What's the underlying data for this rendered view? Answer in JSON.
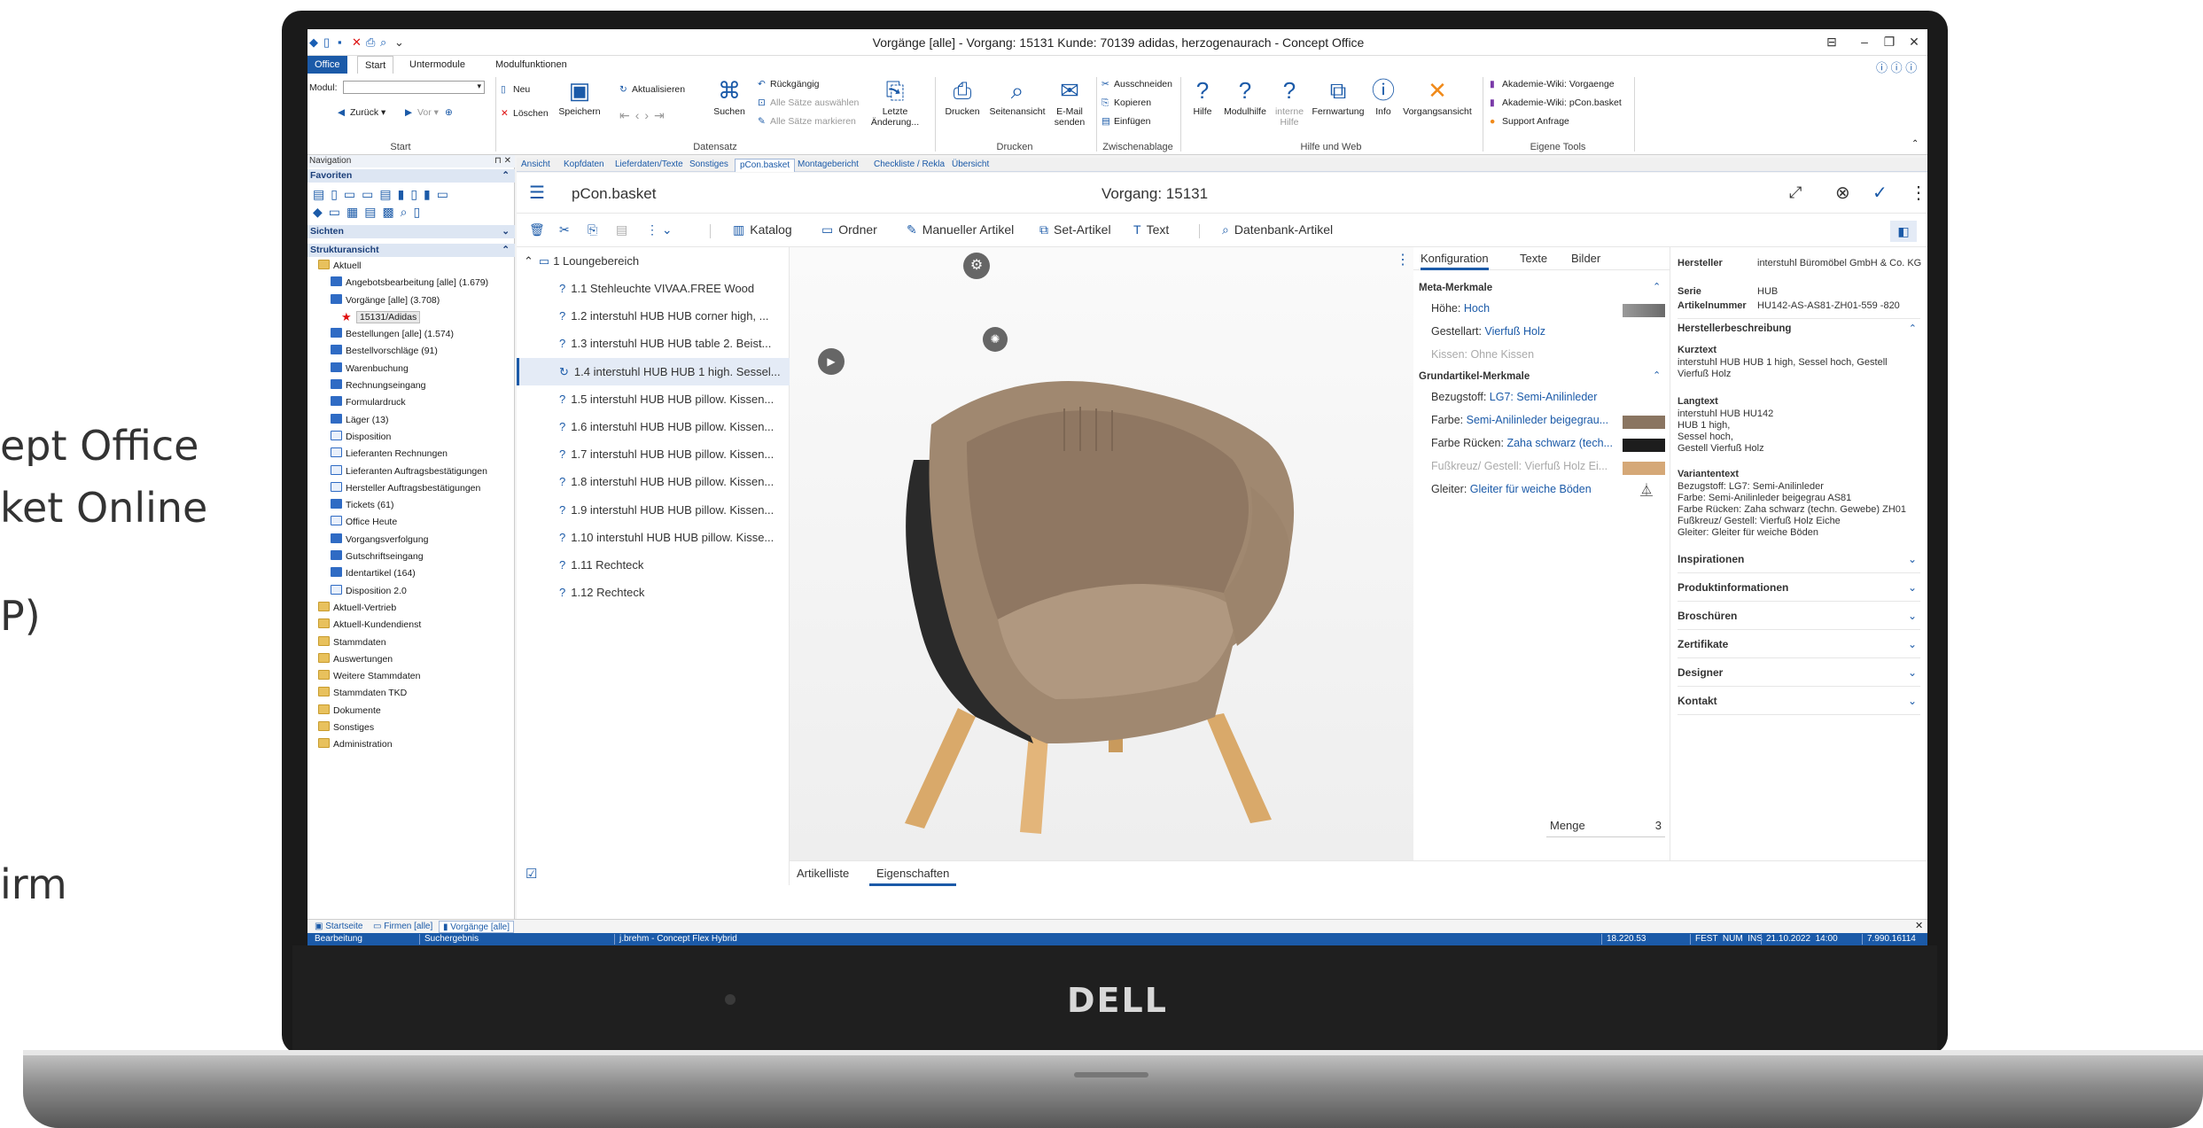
{
  "left_marketing": [
    "ept Office",
    "ket Online",
    "P)",
    "irm"
  ],
  "brand": "DELL",
  "window": {
    "title": "Vorgänge [alle] - Vorgang: 15131 Kunde: 70139 adidas, herzogenaurach - Concept Office",
    "controls": [
      "⊟",
      "–",
      "❐",
      "✕"
    ]
  },
  "ribbon_tabs": [
    "Office",
    "Start",
    "Untermodule",
    "Modulfunktionen"
  ],
  "ribbon": {
    "modul_label": "Modul:",
    "zurueck": "Zurück",
    "vor": "Vor",
    "group_start": "Start",
    "neu": "Neu",
    "loeschen": "Löschen",
    "speichern": "Speichern",
    "aktualisieren": "Aktualisieren",
    "suchen": "Suchen",
    "rueckgaengig": "Rückgängig",
    "alle_saetze_auswaehlen": "Alle Sätze auswählen",
    "alle_saetze_markieren": "Alle Sätze markieren",
    "letzte_aenderung": "Letzte Änderung...",
    "group_datensatz": "Datensatz",
    "drucken": "Drucken",
    "seitenansicht": "Seitenansicht",
    "email_senden": "E-Mail senden",
    "group_drucken": "Drucken",
    "ausschneiden": "Ausschneiden",
    "kopieren": "Kopieren",
    "einfuegen": "Einfügen",
    "group_zwischenablage": "Zwischenablage",
    "hilfe": "Hilfe",
    "modulhilfe": "Modulhilfe",
    "interne_hilfe": "interne Hilfe",
    "fernwartung": "Fernwartung",
    "info": "Info",
    "vorgangsansicht": "Vorgangsansicht",
    "group_hilfe": "Hilfe und Web",
    "wiki_vorgaenge": "Akademie-Wiki: Vorgaenge",
    "wiki_pcon": "Akademie-Wiki: pCon.basket",
    "support": "Support Anfrage",
    "group_tools": "Eigene Tools"
  },
  "nav": {
    "title": "Navigation",
    "favoriten": "Favoriten",
    "sichten": "Sichten",
    "strukturansicht": "Strukturansicht",
    "tree": [
      {
        "label": "Aktuell",
        "level": 1,
        "icon": "folder"
      },
      {
        "label": "Angebotsbearbeitung [alle] (1.679)",
        "level": 2,
        "icon": "doc"
      },
      {
        "label": "Vorgänge [alle] (3.708)",
        "level": 2,
        "icon": "doc"
      },
      {
        "label": "15131/Adidas",
        "level": 3,
        "icon": "star",
        "selected": true
      },
      {
        "label": "Bestellungen [alle] (1.574)",
        "level": 2,
        "icon": "doc"
      },
      {
        "label": "Bestellvorschläge (91)",
        "level": 2,
        "icon": "doc"
      },
      {
        "label": "Warenbuchung",
        "level": 2,
        "icon": "doc"
      },
      {
        "label": "Rechnungseingang",
        "level": 2,
        "icon": "doc"
      },
      {
        "label": "Formulardruck",
        "level": 2,
        "icon": "doc"
      },
      {
        "label": "Läger (13)",
        "level": 2,
        "icon": "doc"
      },
      {
        "label": "Disposition",
        "level": 2,
        "icon": "docout"
      },
      {
        "label": "Lieferanten Rechnungen",
        "level": 2,
        "icon": "docout"
      },
      {
        "label": "Lieferanten Auftragsbestätigungen",
        "level": 2,
        "icon": "docout"
      },
      {
        "label": "Hersteller Auftragsbestätigungen",
        "level": 2,
        "icon": "docout"
      },
      {
        "label": "Tickets (61)",
        "level": 2,
        "icon": "doc"
      },
      {
        "label": "Office Heute",
        "level": 2,
        "icon": "docout"
      },
      {
        "label": "Vorgangsverfolgung",
        "level": 2,
        "icon": "doc"
      },
      {
        "label": "Gutschriftseingang",
        "level": 2,
        "icon": "doc"
      },
      {
        "label": "Identartikel (164)",
        "level": 2,
        "icon": "doc"
      },
      {
        "label": "Disposition 2.0",
        "level": 2,
        "icon": "docout"
      },
      {
        "label": "Aktuell-Vertrieb",
        "level": 1,
        "icon": "folder"
      },
      {
        "label": "Aktuell-Kundendienst",
        "level": 1,
        "icon": "folder"
      },
      {
        "label": "Stammdaten",
        "level": 1,
        "icon": "folder"
      },
      {
        "label": "Auswertungen",
        "level": 1,
        "icon": "folder"
      },
      {
        "label": "Weitere Stammdaten",
        "level": 1,
        "icon": "folder"
      },
      {
        "label": "Stammdaten TKD",
        "level": 1,
        "icon": "folder"
      },
      {
        "label": "Dokumente",
        "level": 1,
        "icon": "folder"
      },
      {
        "label": "Sonstiges",
        "level": 1,
        "icon": "folder"
      },
      {
        "label": "Administration",
        "level": 1,
        "icon": "folder"
      }
    ]
  },
  "doc_tabs": [
    "Ansicht",
    "Kopfdaten",
    "Lieferdaten/Texte",
    "Sonstiges",
    "pCon.basket",
    "Montagebericht",
    "Checkliste / Rekla",
    "Übersicht"
  ],
  "pcon": {
    "title": "pCon.basket",
    "vorgang": "Vorgang: 15131",
    "toolbar": {
      "katalog": "Katalog",
      "ordner": "Ordner",
      "manueller_artikel": "Manueller Artikel",
      "set_artikel": "Set-Artikel",
      "text": "Text",
      "datenbank_artikel": "Datenbank-Artikel"
    },
    "group": "1 Loungebereich",
    "items": [
      "1.1 Stehleuchte VIVAA.FREE Wood",
      "1.2 interstuhl HUB HUB corner high, ...",
      "1.3 interstuhl HUB HUB table 2. Beist...",
      "1.4 interstuhl HUB HUB 1 high. Sessel...",
      "1.5 interstuhl HUB HUB pillow. Kissen...",
      "1.6 interstuhl HUB HUB pillow. Kissen...",
      "1.7 interstuhl HUB HUB pillow. Kissen...",
      "1.8 interstuhl HUB HUB pillow. Kissen...",
      "1.9 interstuhl HUB HUB pillow. Kissen...",
      "1.10 interstuhl HUB HUB pillow. Kisse...",
      "1.11 Rechteck",
      "1.12 Rechteck"
    ],
    "config_tabs": [
      "Konfiguration",
      "Texte",
      "Bilder"
    ],
    "meta_title": "Meta-Merkmale",
    "hoehe_label": "Höhe:",
    "hoehe_value": "Hoch",
    "gestell_label": "Gestellart:",
    "gestell_value": "Vierfuß Holz",
    "kissen": "Kissen: Ohne Kissen",
    "grund_title": "Grundartikel-Merkmale",
    "bezug_label": "Bezugstoff:",
    "bezug_value": "LG7: Semi-Anilinleder",
    "farbe_label": "Farbe:",
    "farbe_value": "Semi-Anilinleder beigegrau...",
    "ruecken_label": "Farbe Rücken:",
    "ruecken_value": "Zaha schwarz (tech...",
    "fusskreuz": "Fußkreuz/ Gestell: Vierfuß Holz Ei...",
    "gleiter_label": "Gleiter:",
    "gleiter_value": "Gleiter für weiche Böden",
    "menge_label": "Menge",
    "menge_value": "3",
    "info": {
      "hersteller_label": "Hersteller",
      "hersteller_value": "interstuhl Büromöbel GmbH & Co. KG",
      "serie_label": "Serie",
      "serie_value": "HUB",
      "artnr_label": "Artikelnummer",
      "artnr_value": "HU142-AS-AS81-ZH01-559 -820",
      "beschreibung": "Herstellerbeschreibung",
      "kurztext_title": "Kurztext",
      "kurztext": "interstuhl HUB HUB 1 high, Sessel hoch, Gestell Vierfuß Holz",
      "langtext_title": "Langtext",
      "langtext": [
        "interstuhl HUB HU142",
        "HUB 1 high,",
        "Sessel hoch,",
        "Gestell Vierfuß Holz"
      ],
      "variantentext_title": "Variantentext",
      "variantentext": [
        "Bezugstoff: LG7: Semi-Anilinleder",
        "Farbe: Semi-Anilinleder beigegrau AS81",
        "Farbe Rücken: Zaha schwarz (techn. Gewebe) ZH01",
        "Fußkreuz/ Gestell: Vierfuß Holz Eiche",
        "Gleiter: Gleiter für weiche Böden"
      ],
      "sections": [
        "Inspirationen",
        "Produktinformationen",
        "Broschüren",
        "Zertifikate",
        "Designer",
        "Kontakt"
      ]
    },
    "bottom_tabs": [
      "Artikelliste",
      "Eigenschaften"
    ]
  },
  "window_tabs": [
    "Startseite",
    "Firmen [alle]",
    "Vorgänge [alle]"
  ],
  "status": {
    "mode": "Bearbeitung",
    "search": "Suchergebnis",
    "user": "j.brehm - Concept Flex Hybrid",
    "version": "18.220.53",
    "keys": "FEST  NUM  INS",
    "datetime": "21.10.2022  14:00",
    "build": "7.990.16114"
  },
  "colors": {
    "accent": "#1b5aa8",
    "leather": "#a08870",
    "wood": "#d9a96a",
    "back": "#2a2a2a"
  }
}
